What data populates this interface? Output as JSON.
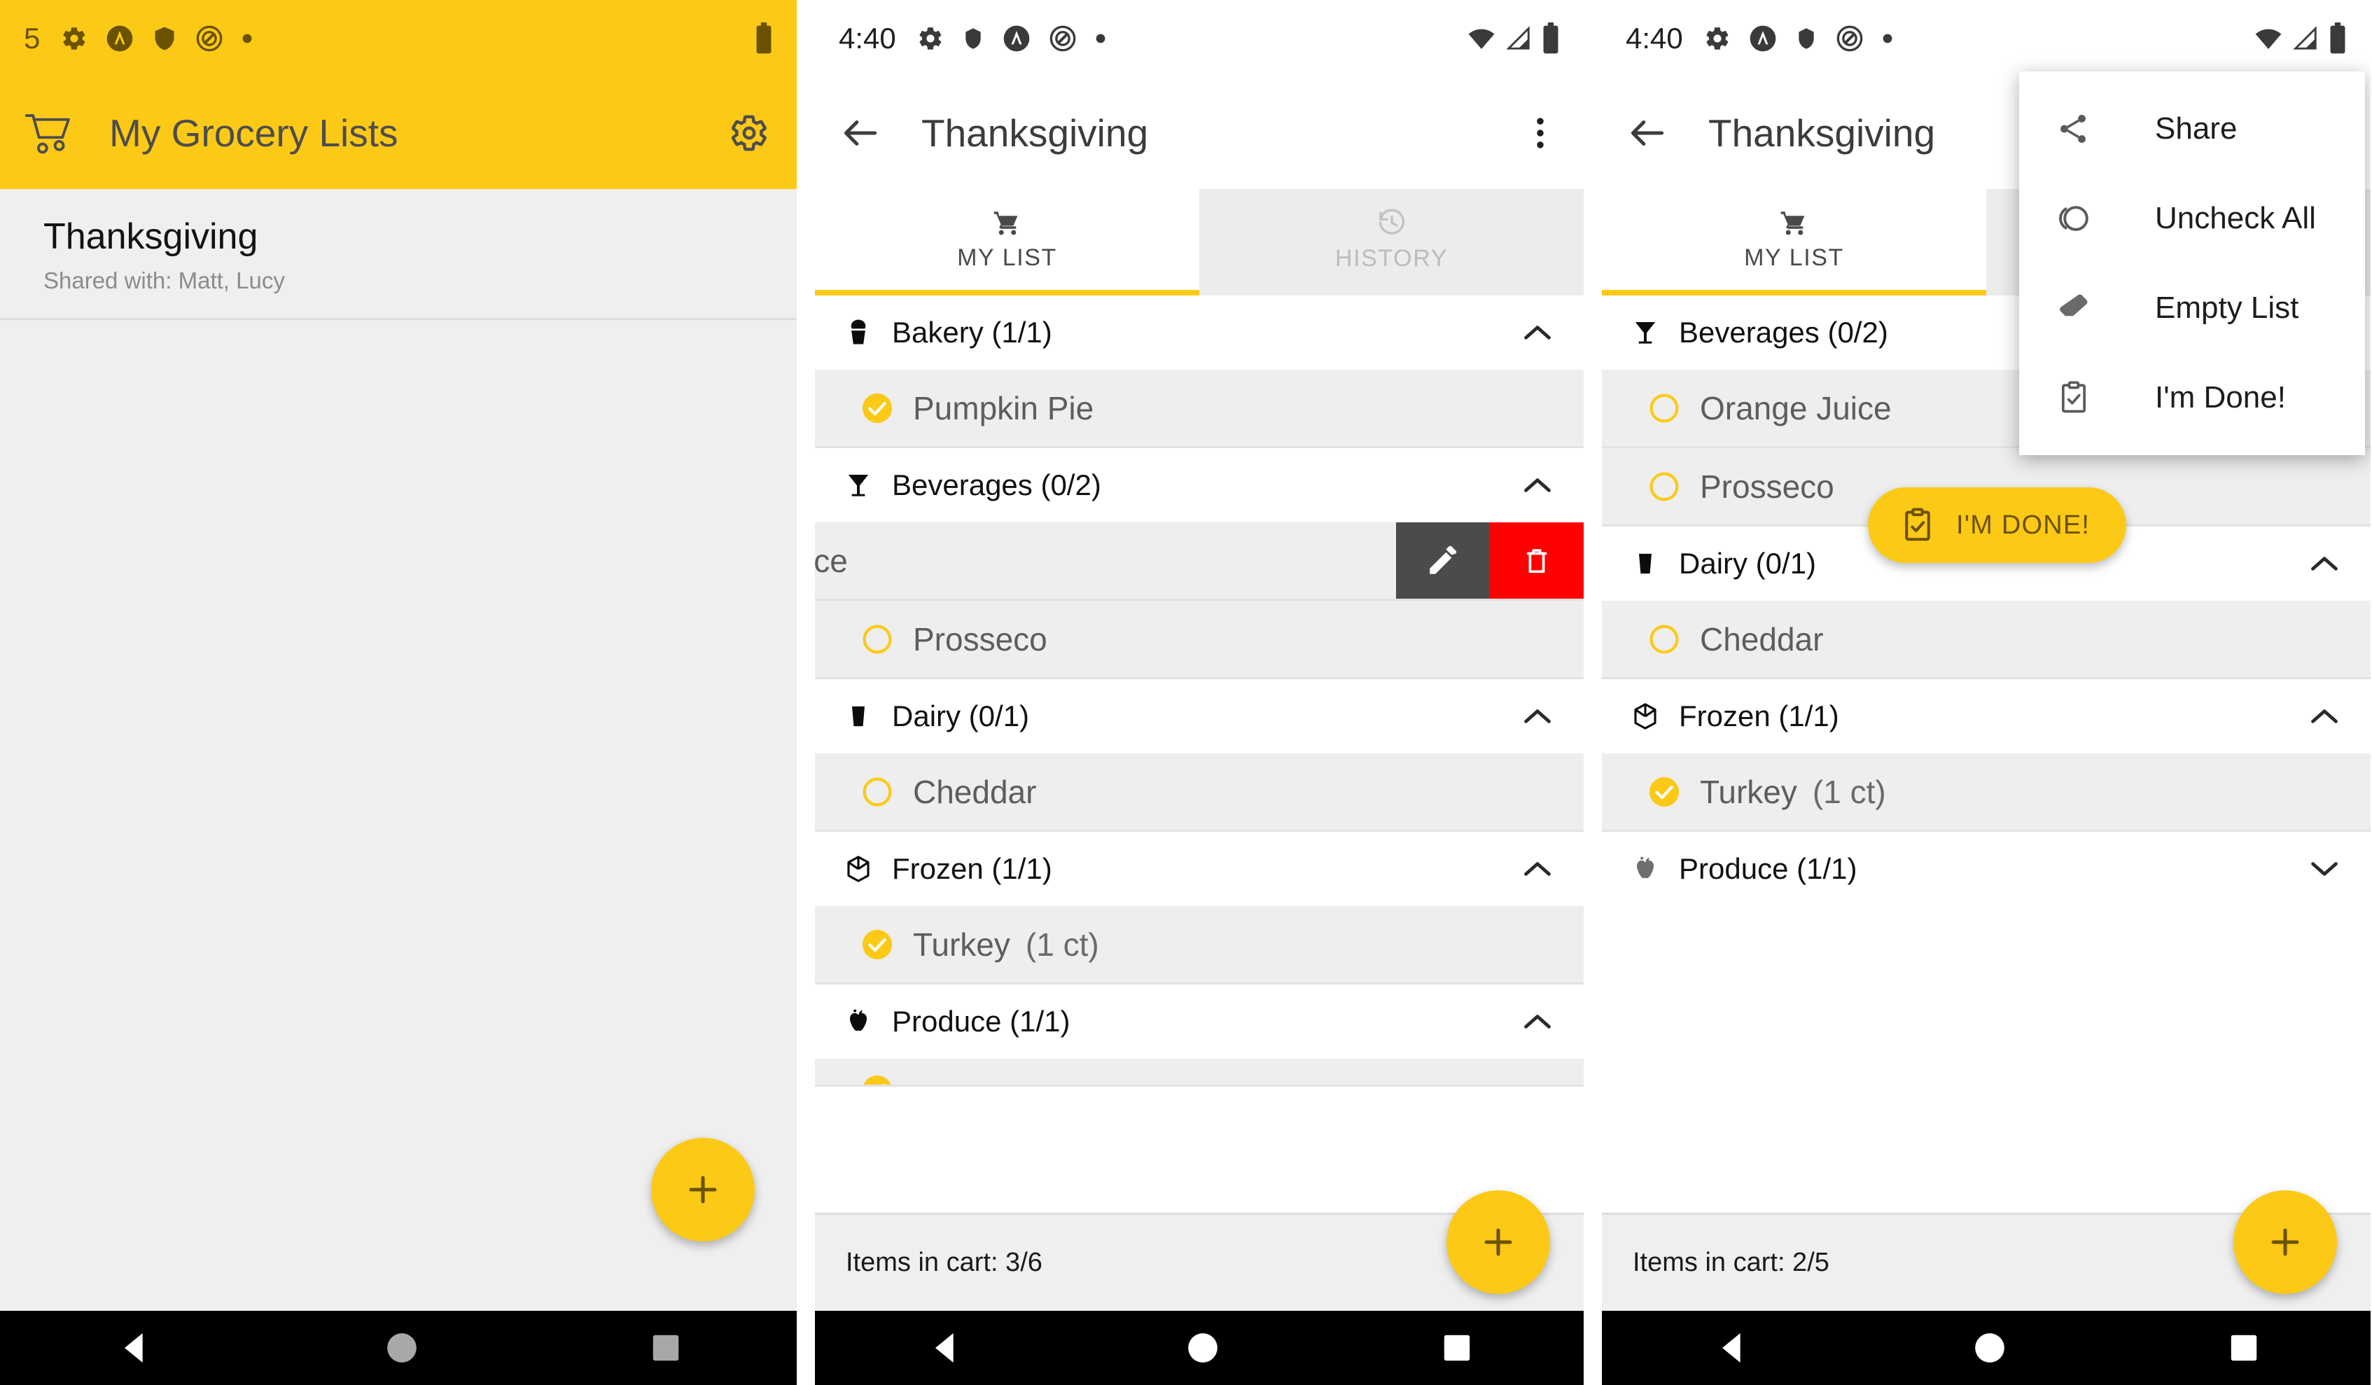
{
  "theme": {
    "accent": "#FCC917",
    "accent_dark": "#6b5200",
    "item_bg": "#eeeeee",
    "delete_red": "#ff0000",
    "edit_gray": "#4b4b4b",
    "text_primary": "#111111",
    "text_secondary": "#5d5d5d",
    "nav_black": "#000000"
  },
  "panel1": {
    "statusbar": {
      "clock": "5",
      "icons": [
        "gear-icon",
        "a-circle-icon",
        "shield-icon",
        "quiet-mode-icon",
        "dot-icon"
      ],
      "right_icons": [
        "battery-icon"
      ]
    },
    "appbar": {
      "logo_icon": "shopping-cart-icon",
      "title": "My Grocery Lists",
      "settings_icon": "gear-icon"
    },
    "lists": [
      {
        "name": "Thanksgiving",
        "shared": "Shared with: Matt, Lucy"
      }
    ],
    "fab": {
      "icon": "plus-icon",
      "label": "+"
    },
    "navbar": [
      "back-triangle-icon",
      "home-circle-icon",
      "recents-square-icon"
    ]
  },
  "panel2": {
    "statusbar": {
      "clock": "4:40",
      "icons": [
        "gear-icon",
        "shield-icon",
        "a-circle-icon",
        "quiet-mode-icon",
        "dot-icon"
      ],
      "right_icons": [
        "wifi-icon",
        "signal-icon",
        "battery-icon"
      ]
    },
    "appbar": {
      "back_icon": "back-arrow-icon",
      "title": "Thanksgiving",
      "overflow_icon": "more-vert-icon"
    },
    "tabs": [
      {
        "label": "MY LIST",
        "icon": "shopping-cart-icon",
        "active": true
      },
      {
        "label": "HISTORY",
        "icon": "history-icon",
        "active": false
      }
    ],
    "categories": [
      {
        "icon": "cupcake-icon",
        "label": "Bakery (1/1)",
        "expanded": true,
        "chevron": "chevron-up-icon",
        "items": [
          {
            "name": "Pumpkin Pie",
            "qty": "",
            "checked": true,
            "swiped": false
          }
        ]
      },
      {
        "icon": "cocktail-glass-icon",
        "label": "Beverages (0/2)",
        "expanded": true,
        "chevron": "chevron-up-icon",
        "items": [
          {
            "name": "ice",
            "qty": "",
            "checked": false,
            "swiped": true,
            "actions": [
              {
                "name": "edit",
                "icon": "pencil-icon"
              },
              {
                "name": "delete",
                "icon": "trash-icon"
              }
            ]
          },
          {
            "name": "Prosseco",
            "qty": "",
            "checked": false,
            "swiped": false
          }
        ]
      },
      {
        "icon": "milk-glass-icon",
        "label": "Dairy (0/1)",
        "expanded": true,
        "chevron": "chevron-up-icon",
        "items": [
          {
            "name": "Cheddar",
            "qty": "",
            "checked": false,
            "swiped": false
          }
        ]
      },
      {
        "icon": "frozen-cube-icon",
        "label": "Frozen (1/1)",
        "expanded": true,
        "chevron": "chevron-up-icon",
        "items": [
          {
            "name": "Turkey",
            "qty": "(1 ct)",
            "checked": true,
            "swiped": false
          }
        ]
      },
      {
        "icon": "apple-icon",
        "label": "Produce (1/1)",
        "expanded": true,
        "chevron": "chevron-up-icon",
        "items": [
          {
            "name": "",
            "qty": "",
            "checked": true,
            "swiped": false,
            "clipped": true
          }
        ]
      }
    ],
    "bottombar": {
      "cart_count": "Items in cart: 3/6"
    },
    "fab": {
      "icon": "plus-icon",
      "label": "+"
    },
    "navbar": [
      "back-triangle-icon",
      "home-circle-icon",
      "recents-square-icon"
    ]
  },
  "panel3": {
    "statusbar": {
      "clock": "4:40",
      "icons": [
        "gear-icon",
        "a-circle-icon",
        "shield-icon",
        "quiet-mode-icon",
        "dot-icon"
      ],
      "right_icons": [
        "wifi-icon",
        "signal-icon",
        "battery-icon"
      ]
    },
    "appbar": {
      "back_icon": "back-arrow-icon",
      "title": "Thanksgiving",
      "overflow_icon": "more-vert-icon"
    },
    "tabs": [
      {
        "label": "MY LIST",
        "icon": "shopping-cart-icon",
        "active": true
      }
    ],
    "menu": [
      {
        "label": "Share",
        "icon": "share-icon"
      },
      {
        "label": "Uncheck All",
        "icon": "uncheck-all-icon"
      },
      {
        "label": "Empty List",
        "icon": "eraser-icon"
      },
      {
        "label": "I'm Done!",
        "icon": "clipboard-check-icon"
      }
    ],
    "categories": [
      {
        "icon": "cocktail-glass-icon",
        "label": "Beverages (0/2)",
        "expanded": true,
        "chevron": "",
        "items": [
          {
            "name": "Orange Juice",
            "qty": "",
            "checked": false
          },
          {
            "name": "Prosseco",
            "qty": "",
            "checked": false
          }
        ]
      },
      {
        "icon": "milk-glass-icon",
        "label": "Dairy (0/1)",
        "expanded": true,
        "chevron": "chevron-up-icon",
        "items": [
          {
            "name": "Cheddar",
            "qty": "",
            "checked": false
          }
        ]
      },
      {
        "icon": "frozen-cube-icon",
        "label": "Frozen (1/1)",
        "expanded": true,
        "chevron": "chevron-up-icon",
        "items": [
          {
            "name": "Turkey",
            "qty": "(1 ct)",
            "checked": true
          }
        ]
      },
      {
        "icon": "apple-icon",
        "label": "Produce (1/1)",
        "expanded": false,
        "chevron": "chevron-down-icon",
        "items": []
      }
    ],
    "done_button": {
      "label": "I'M DONE!",
      "icon": "clipboard-check-icon"
    },
    "bottombar": {
      "cart_count": "Items in cart: 2/5"
    },
    "fab": {
      "icon": "plus-icon",
      "label": "+"
    },
    "navbar": [
      "back-triangle-icon",
      "home-circle-icon",
      "recents-square-icon"
    ]
  }
}
